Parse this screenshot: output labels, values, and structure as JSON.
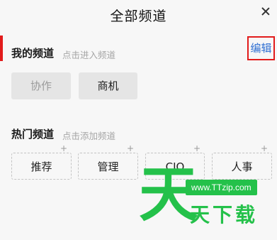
{
  "header": {
    "title": "全部频道"
  },
  "my_channels": {
    "title": "我的频道",
    "hint": "点击进入频道",
    "edit_label": "编辑",
    "items": [
      {
        "label": "协作",
        "fixed": true
      },
      {
        "label": "商机",
        "fixed": false
      }
    ]
  },
  "hot_channels": {
    "title": "热门频道",
    "hint": "点击添加频道",
    "add_symbol": "+",
    "items": [
      {
        "label": "推荐"
      },
      {
        "label": "管理"
      },
      {
        "label": "CIO"
      },
      {
        "label": "人事"
      }
    ]
  },
  "watermark": {
    "glyph": "天",
    "url": "www.TTzip.com",
    "text": "天下载"
  },
  "colors": {
    "accent_red": "#e21b1b",
    "link_blue": "#2f6fd2",
    "watermark_green": "#24c14a"
  }
}
